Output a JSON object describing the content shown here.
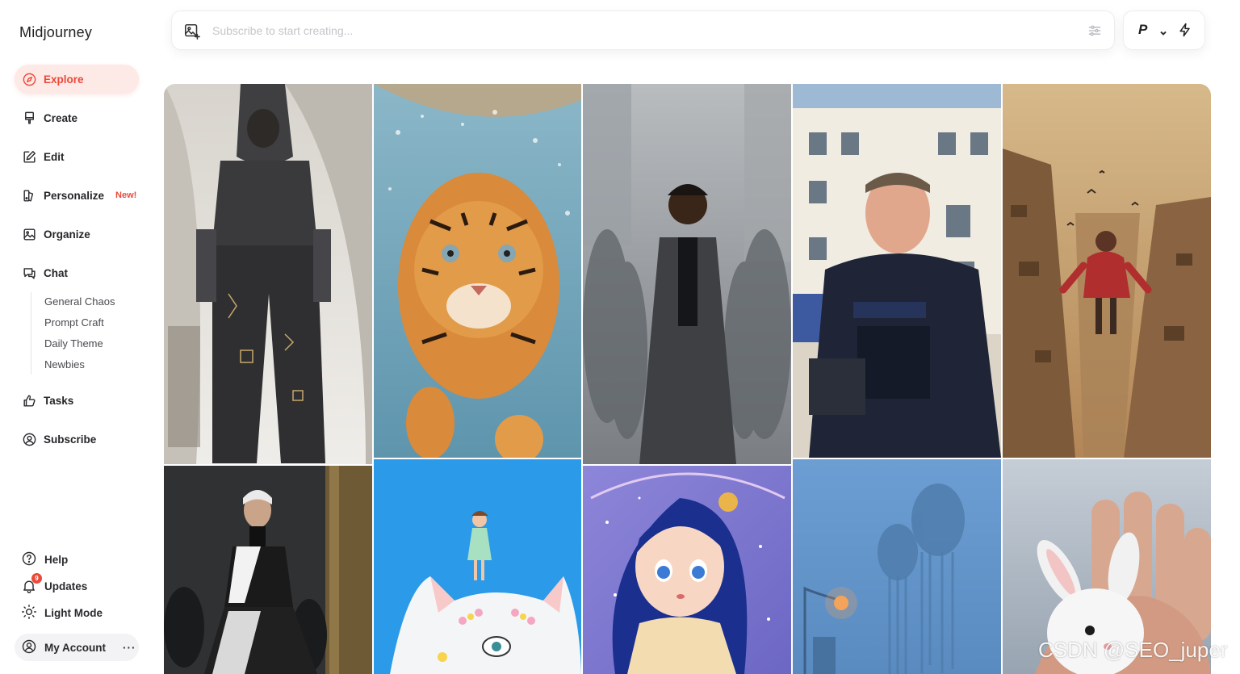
{
  "app": {
    "title": "Midjourney"
  },
  "nav": {
    "explore": "Explore",
    "create": "Create",
    "edit": "Edit",
    "personalize": "Personalize",
    "personalize_badge": "New!",
    "organize": "Organize",
    "chat": "Chat",
    "chat_rooms": [
      "General Chaos",
      "Prompt Craft",
      "Daily Theme",
      "Newbies"
    ],
    "tasks": "Tasks",
    "subscribe": "Subscribe"
  },
  "footer": {
    "help": "Help",
    "updates": "Updates",
    "updates_count": "9",
    "light_mode": "Light Mode",
    "account": "My Account",
    "more": "···"
  },
  "topbar": {
    "placeholder": "Subscribe to start creating...",
    "personalize_toggle": "P"
  },
  "gallery": {
    "items": [
      {
        "icon": "runway-model-image"
      },
      {
        "icon": "tiger-underwater-image"
      },
      {
        "icon": "man-in-crowd-image"
      },
      {
        "icon": "police-officer-image"
      },
      {
        "icon": "flying-child-city-image"
      },
      {
        "icon": "fashion-model-night-image"
      },
      {
        "icon": "girl-on-cat-image"
      },
      {
        "icon": "anime-girl-image"
      },
      {
        "icon": "giants-in-fog-image"
      },
      {
        "icon": "bunny-in-hand-image"
      }
    ]
  },
  "watermark": "CSDN @SEO_juper",
  "colors": {
    "accent": "#ea4a39",
    "accent_bg": "#fde9e6"
  }
}
